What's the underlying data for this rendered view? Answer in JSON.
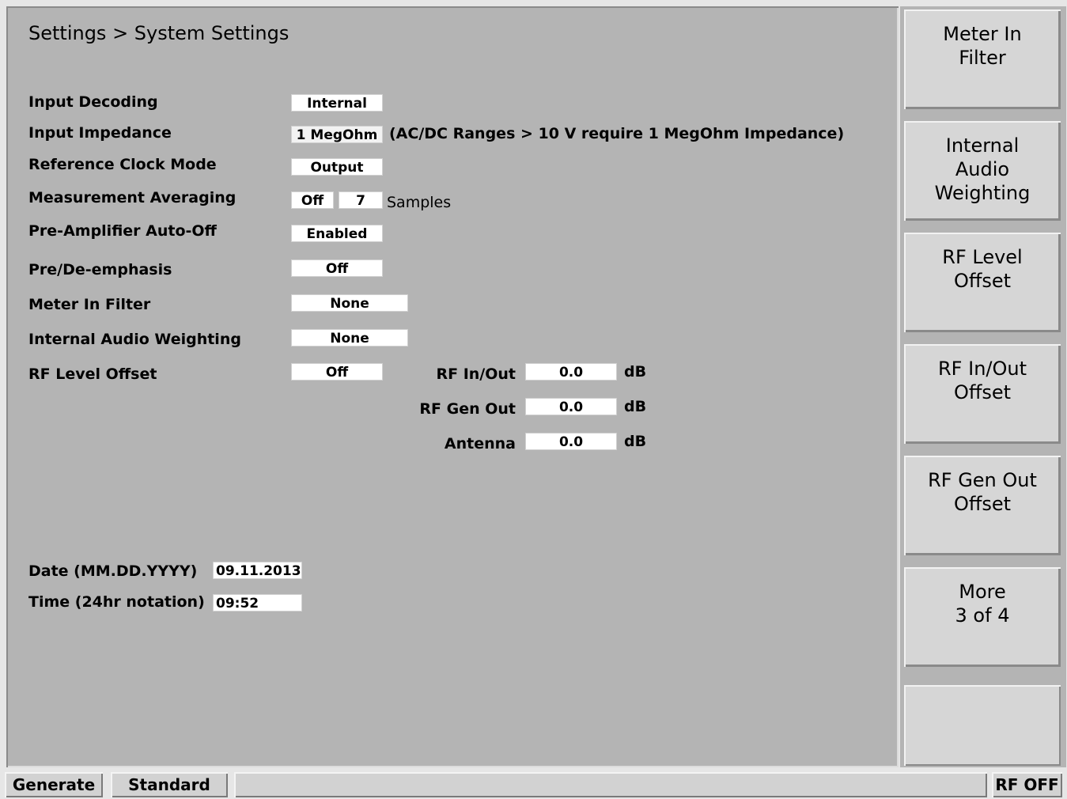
{
  "breadcrumb": "Settings > System Settings",
  "settings": {
    "input_decoding": {
      "label": "Input Decoding",
      "value": "Internal"
    },
    "input_impedance": {
      "label": "Input Impedance",
      "value": "1 MegOhm",
      "note": "(AC/DC  Ranges > 10 V require 1 MegOhm Impedance)"
    },
    "reference_clock_mode": {
      "label": "Reference Clock Mode",
      "value": "Output"
    },
    "measurement_averaging": {
      "label": "Measurement Averaging",
      "value": "Off",
      "samples": "7",
      "samples_label": "Samples"
    },
    "preamp_auto_off": {
      "label": "Pre-Amplifier Auto-Off",
      "value": "Enabled"
    },
    "pre_de_emphasis": {
      "label": "Pre/De-emphasis",
      "value": "Off"
    },
    "meter_in_filter": {
      "label": "Meter In Filter",
      "value": "None"
    },
    "internal_audio_weighting": {
      "label": "Internal Audio Weighting",
      "value": "None"
    },
    "rf_level_offset": {
      "label": "RF Level Offset",
      "value": "Off"
    }
  },
  "offsets": {
    "rf_in_out": {
      "label": "RF In/Out",
      "value": "0.0",
      "unit": "dB"
    },
    "rf_gen_out": {
      "label": "RF Gen Out",
      "value": "0.0",
      "unit": "dB"
    },
    "antenna": {
      "label": "Antenna",
      "value": "0.0",
      "unit": "dB"
    }
  },
  "datetime": {
    "date_label": "Date  (MM.DD.YYYY)",
    "date_value": "09.11.2013",
    "time_label": "Time (24hr notation)",
    "time_value": "09:52"
  },
  "softkeys": [
    {
      "line1": "Meter In",
      "line2": "Filter",
      "line3": ""
    },
    {
      "line1": "Internal",
      "line2": "Audio",
      "line3": "Weighting"
    },
    {
      "line1": "RF Level",
      "line2": "Offset",
      "line3": ""
    },
    {
      "line1": "RF In/Out",
      "line2": "Offset",
      "line3": ""
    },
    {
      "line1": "RF Gen Out",
      "line2": "Offset",
      "line3": ""
    },
    {
      "line1": "More",
      "line2": "3 of 4",
      "line3": ""
    }
  ],
  "status": {
    "mode": "Generate",
    "standard": "Standard",
    "message": "",
    "rf_state": "RF OFF"
  }
}
